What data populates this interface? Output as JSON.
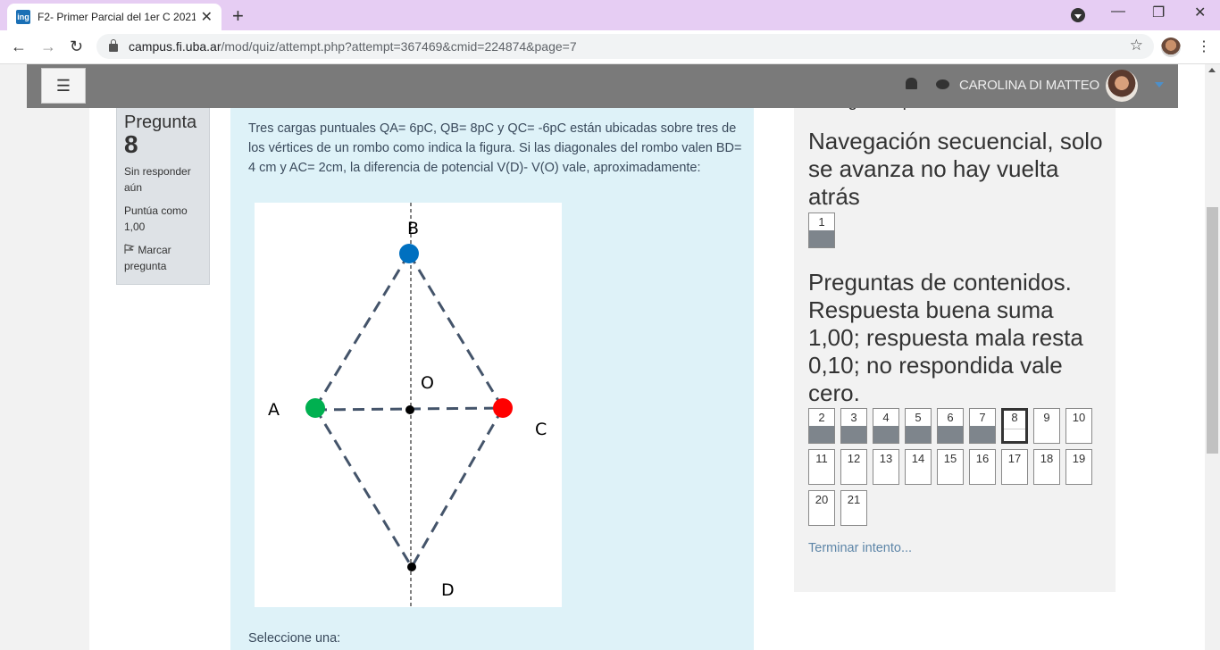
{
  "browser": {
    "tab_title": "F2- Primer Parcial del 1er C 2021",
    "favicon_text": "ing",
    "url_domain": "campus.fi.uba.ar",
    "url_path": "/mod/quiz/attempt.php?attempt=367469&cmid=224874&page=7"
  },
  "navbar": {
    "user_name": "CAROLINA DI MATTEO"
  },
  "question_info": {
    "label": "Pregunta",
    "number": "8",
    "status": "Sin responder aún",
    "score": "Puntúa como 1,00",
    "flag": "Marcar pregunta"
  },
  "question": {
    "text": "Tres cargas puntuales QA= 6pC, QB= 8pC y QC= -6pC están ubicadas sobre tres de los vértices de un rombo como indica la figura. Si las diagonales del rombo valen BD= 4 cm y AC= 2cm, la diferencia de potencial V(D)- V(O) vale, aproximadamente:",
    "select_prompt": "Seleccione una:",
    "figure": {
      "labels": {
        "A": "A",
        "B": "B",
        "C": "C",
        "D": "D",
        "O": "O"
      },
      "colors": {
        "A": "#00b050",
        "B": "#0070c0",
        "C": "#ff0000",
        "dash": "#44546a"
      }
    }
  },
  "quiz_nav": {
    "heading": "Navegación por el cuestionario",
    "section1_title": "Navegación secuencial, solo se avanza no hay vuelta atrás",
    "section2_title": "Preguntas de contenidos. Respuesta buena suma 1,00; respuesta mala resta 0,10; no respondida vale cero.",
    "section1_buttons": [
      "1"
    ],
    "section2_buttons": [
      "2",
      "3",
      "4",
      "5",
      "6",
      "7",
      "8",
      "9",
      "10",
      "11",
      "12",
      "13",
      "14",
      "15",
      "16",
      "17",
      "18",
      "19",
      "20",
      "21"
    ],
    "finish_label": "Terminar intento..."
  }
}
